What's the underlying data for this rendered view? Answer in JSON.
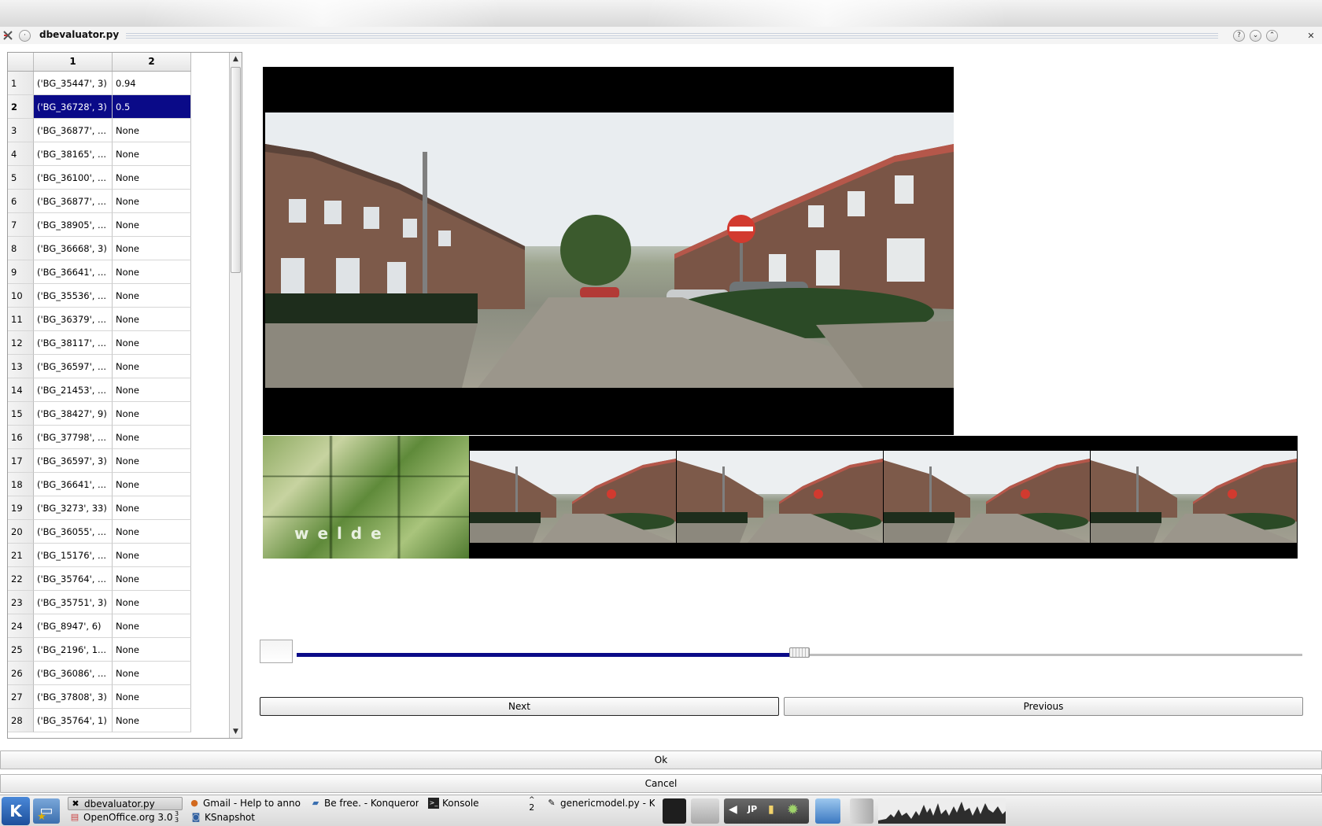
{
  "window": {
    "title": "dbevaluator.py",
    "menu_icon": "x-icon",
    "controls": [
      "?",
      "⌄",
      "⌃",
      "✕"
    ]
  },
  "table": {
    "columns": [
      "1",
      "2"
    ],
    "selected_row": 2,
    "rows": [
      {
        "n": "1",
        "c1": "('BG_35447', 3)",
        "c2": "0.94"
      },
      {
        "n": "2",
        "c1": "('BG_36728', 3)",
        "c2": "0.5"
      },
      {
        "n": "3",
        "c1": "('BG_36877', ...",
        "c2": "None"
      },
      {
        "n": "4",
        "c1": "('BG_38165', ...",
        "c2": "None"
      },
      {
        "n": "5",
        "c1": "('BG_36100', ...",
        "c2": "None"
      },
      {
        "n": "6",
        "c1": "('BG_36877', ...",
        "c2": "None"
      },
      {
        "n": "7",
        "c1": "('BG_38905', ...",
        "c2": "None"
      },
      {
        "n": "8",
        "c1": "('BG_36668', 3)",
        "c2": "None"
      },
      {
        "n": "9",
        "c1": "('BG_36641', ...",
        "c2": "None"
      },
      {
        "n": "10",
        "c1": "('BG_35536', ...",
        "c2": "None"
      },
      {
        "n": "11",
        "c1": "('BG_36379', ...",
        "c2": "None"
      },
      {
        "n": "12",
        "c1": "('BG_38117', ...",
        "c2": "None"
      },
      {
        "n": "13",
        "c1": "('BG_36597', ...",
        "c2": "None"
      },
      {
        "n": "14",
        "c1": "('BG_21453', ...",
        "c2": "None"
      },
      {
        "n": "15",
        "c1": "('BG_38427', 9)",
        "c2": "None"
      },
      {
        "n": "16",
        "c1": "('BG_37798', ...",
        "c2": "None"
      },
      {
        "n": "17",
        "c1": "('BG_36597', 3)",
        "c2": "None"
      },
      {
        "n": "18",
        "c1": "('BG_36641', ...",
        "c2": "None"
      },
      {
        "n": "19",
        "c1": "('BG_3273', 33)",
        "c2": "None"
      },
      {
        "n": "20",
        "c1": "('BG_36055', ...",
        "c2": "None"
      },
      {
        "n": "21",
        "c1": "('BG_15176', ...",
        "c2": "None"
      },
      {
        "n": "22",
        "c1": "('BG_35764', ...",
        "c2": "None"
      },
      {
        "n": "23",
        "c1": "('BG_35751', 3)",
        "c2": "None"
      },
      {
        "n": "24",
        "c1": "('BG_8947', 6)",
        "c2": "None"
      },
      {
        "n": "25",
        "c1": "('BG_2196', 1...",
        "c2": "None"
      },
      {
        "n": "26",
        "c1": "('BG_36086', ...",
        "c2": "None"
      },
      {
        "n": "27",
        "c1": "('BG_37808', 3)",
        "c2": "None"
      },
      {
        "n": "28",
        "c1": "('BG_35764', 1)",
        "c2": "None"
      }
    ]
  },
  "video": {
    "thumbnail_text": "w e l d e",
    "slider_fraction": 0.5
  },
  "buttons": {
    "next": "Next",
    "previous": "Previous",
    "ok": "Ok",
    "cancel": "Cancel"
  },
  "taskbar": {
    "tasks_top": [
      {
        "label": "dbevaluator.py",
        "icon": "x-icon"
      },
      {
        "label": "Gmail - Help to anno",
        "icon": "firefox-icon"
      },
      {
        "label": "Be free. - Konqueror",
        "icon": "folder-icon"
      },
      {
        "label": "Konsole",
        "icon": "terminal-icon"
      },
      {
        "label": "genericmodel.py - Ka",
        "icon": "editor-icon"
      }
    ],
    "tasks_bottom": [
      {
        "label": "OpenOffice.org 3.0",
        "icon": "openoffice-icon"
      },
      {
        "label": "KSnapshot",
        "icon": "camera-icon"
      }
    ],
    "desktop_pager": "2",
    "pager_small": [
      "3",
      "3"
    ]
  },
  "colors": {
    "selection": "#0a0a88",
    "slider_fill": "#0a0a88"
  }
}
